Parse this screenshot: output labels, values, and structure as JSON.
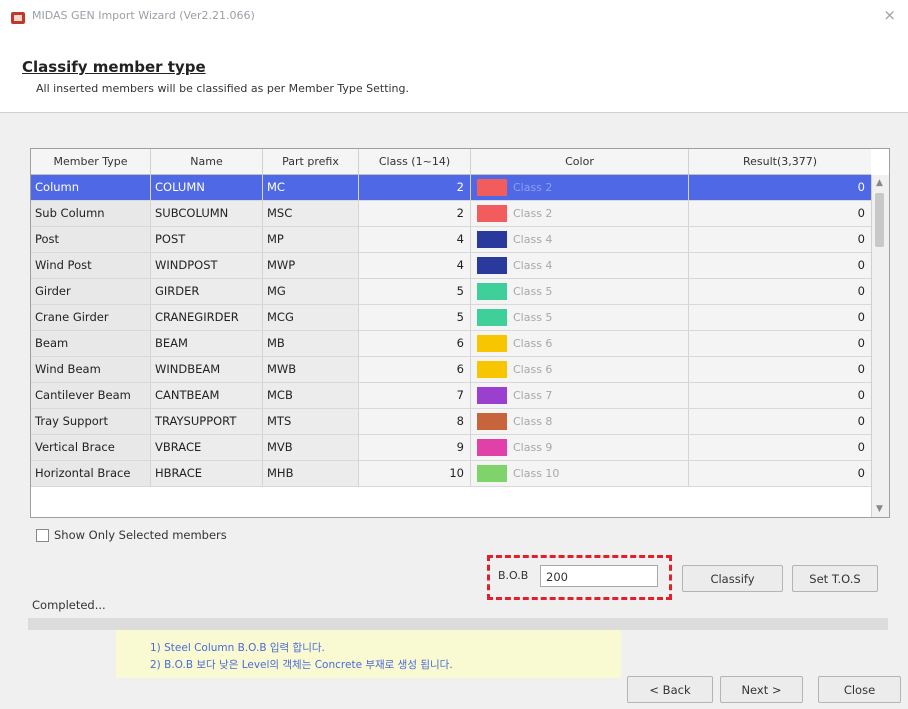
{
  "window": {
    "title": "MIDAS GEN Import Wizard (Ver2.21.066)",
    "close_glyph": "×"
  },
  "header": {
    "title": "Classify member type",
    "subtitle": "All inserted members will be classified as per Member Type Setting."
  },
  "table": {
    "columns": [
      "Member Type",
      "Name",
      "Part prefix",
      "Class (1~14)",
      "Color",
      "Result(3,377)"
    ],
    "rows": [
      {
        "type": "Column",
        "name": "COLUMN",
        "prefix": "MC",
        "class": "2",
        "color": "#f25c5c",
        "class_label": "Class 2",
        "result": "0",
        "selected": true
      },
      {
        "type": "Sub Column",
        "name": "SUBCOLUMN",
        "prefix": "MSC",
        "class": "2",
        "color": "#f25c5c",
        "class_label": "Class 2",
        "result": "0"
      },
      {
        "type": "Post",
        "name": "POST",
        "prefix": "MP",
        "class": "4",
        "color": "#2a3a9c",
        "class_label": "Class 4",
        "result": "0"
      },
      {
        "type": "Wind Post",
        "name": "WINDPOST",
        "prefix": "MWP",
        "class": "4",
        "color": "#2a3a9c",
        "class_label": "Class 4",
        "result": "0"
      },
      {
        "type": "Girder",
        "name": "GIRDER",
        "prefix": "MG",
        "class": "5",
        "color": "#3ecf9a",
        "class_label": "Class 5",
        "result": "0"
      },
      {
        "type": "Crane Girder",
        "name": "CRANEGIRDER",
        "prefix": "MCG",
        "class": "5",
        "color": "#3ecf9a",
        "class_label": "Class 5",
        "result": "0"
      },
      {
        "type": "Beam",
        "name": "BEAM",
        "prefix": "MB",
        "class": "6",
        "color": "#f7c600",
        "class_label": "Class 6",
        "result": "0"
      },
      {
        "type": "Wind Beam",
        "name": "WINDBEAM",
        "prefix": "MWB",
        "class": "6",
        "color": "#f7c600",
        "class_label": "Class 6",
        "result": "0"
      },
      {
        "type": "Cantilever Beam",
        "name": "CANTBEAM",
        "prefix": "MCB",
        "class": "7",
        "color": "#9b3fcf",
        "class_label": "Class 7",
        "result": "0"
      },
      {
        "type": "Tray Support",
        "name": "TRAYSUPPORT",
        "prefix": "MTS",
        "class": "8",
        "color": "#c8643c",
        "class_label": "Class 8",
        "result": "0"
      },
      {
        "type": "Vertical Brace",
        "name": "VBRACE",
        "prefix": "MVB",
        "class": "9",
        "color": "#e040a8",
        "class_label": "Class 9",
        "result": "0"
      },
      {
        "type": "Horizontal Brace",
        "name": "HBRACE",
        "prefix": "MHB",
        "class": "10",
        "color": "#7ed36a",
        "class_label": "Class 10",
        "result": "0"
      }
    ]
  },
  "show_only_label": "Show Only Selected members",
  "bob": {
    "label": "B.O.B",
    "value": "200"
  },
  "buttons": {
    "classify": "Classify",
    "set_tos": "Set T.O.S",
    "back": "< Back",
    "next": "Next >",
    "close": "Close"
  },
  "status_text": "Completed...",
  "note": {
    "line1": "1) Steel Column B.O.B 입력 합니다.",
    "line2": "2) B.O.B 보다 낮은 Level의 객체는 Concrete 부재로 생성 됩니다."
  },
  "colors": {
    "selection": "#4f68e6",
    "highlight_border": "#e0202a",
    "note_bg": "#fafad2"
  }
}
